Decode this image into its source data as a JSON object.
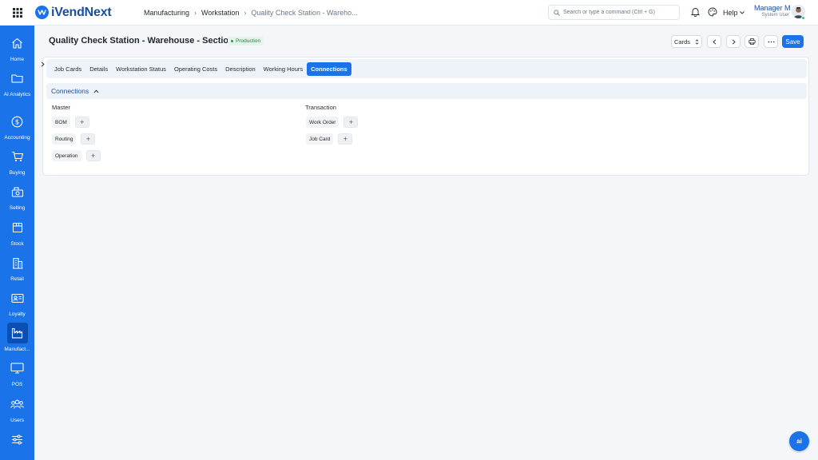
{
  "brand": {
    "name": "iVendNext",
    "accent": "#1a73e8"
  },
  "breadcrumb": {
    "items": [
      "Manufacturing",
      "Workstation",
      "Quality Check Station - Wareho..."
    ]
  },
  "search": {
    "placeholder": "Search or type a command (Ctrl + G)"
  },
  "help": {
    "label": "Help"
  },
  "user": {
    "name": "Manager M",
    "role": "System User"
  },
  "sidebar": {
    "items": [
      {
        "label": "Home",
        "icon": "home-icon"
      },
      {
        "label": "AI Analytics",
        "icon": "folder-icon"
      },
      {
        "label": "Accounting",
        "icon": "dollar-icon"
      },
      {
        "label": "Buying",
        "icon": "cart-icon"
      },
      {
        "label": "Selling",
        "icon": "cash-register-icon"
      },
      {
        "label": "Stock",
        "icon": "box-icon"
      },
      {
        "label": "Retail",
        "icon": "building-icon"
      },
      {
        "label": "Loyalty",
        "icon": "id-card-icon"
      },
      {
        "label": "Manufact...",
        "icon": "factory-icon",
        "active": true
      },
      {
        "label": "POS",
        "icon": "monitor-icon"
      },
      {
        "label": "Users",
        "icon": "users-icon"
      },
      {
        "label": "",
        "icon": "sliders-icon"
      }
    ]
  },
  "page": {
    "title": "Quality Check Station - Warehouse - Section A",
    "status": "Production",
    "view_label": "Cards",
    "save_label": "Save"
  },
  "tabs": [
    {
      "label": "Job Cards"
    },
    {
      "label": "Details"
    },
    {
      "label": "Workstation Status"
    },
    {
      "label": "Operating Costs"
    },
    {
      "label": "Description"
    },
    {
      "label": "Working Hours"
    },
    {
      "label": "Connections",
      "active": true
    }
  ],
  "connections": {
    "title": "Connections",
    "master": {
      "title": "Master",
      "items": [
        "BOM",
        "Routing",
        "Operation"
      ]
    },
    "transaction": {
      "title": "Transaction",
      "items": [
        "Work Order",
        "Job Card"
      ]
    }
  },
  "fab": {
    "label": "ai"
  }
}
